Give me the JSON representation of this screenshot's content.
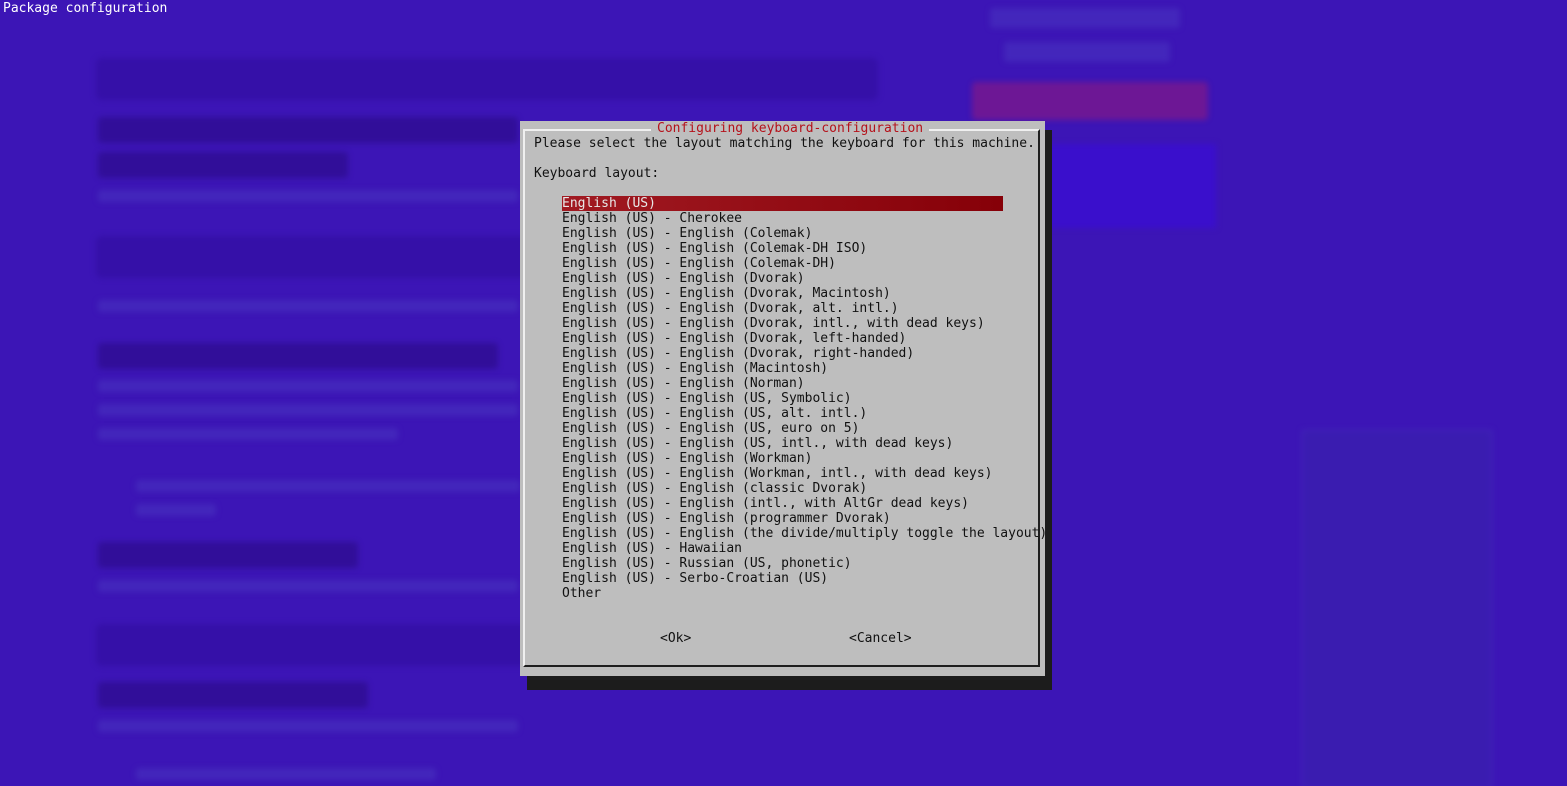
{
  "terminal": {
    "title": "Package configuration"
  },
  "dialog": {
    "title": "Configuring keyboard-configuration",
    "prompt": "Please select the layout matching the keyboard for this machine.",
    "list_label": "Keyboard layout:",
    "selected_index": 0,
    "items": [
      "English (US)",
      "English (US) - Cherokee",
      "English (US) - English (Colemak)",
      "English (US) - English (Colemak-DH ISO)",
      "English (US) - English (Colemak-DH)",
      "English (US) - English (Dvorak)",
      "English (US) - English (Dvorak, Macintosh)",
      "English (US) - English (Dvorak, alt. intl.)",
      "English (US) - English (Dvorak, intl., with dead keys)",
      "English (US) - English (Dvorak, left-handed)",
      "English (US) - English (Dvorak, right-handed)",
      "English (US) - English (Macintosh)",
      "English (US) - English (Norman)",
      "English (US) - English (US, Symbolic)",
      "English (US) - English (US, alt. intl.)",
      "English (US) - English (US, euro on 5)",
      "English (US) - English (US, intl., with dead keys)",
      "English (US) - English (Workman)",
      "English (US) - English (Workman, intl., with dead keys)",
      "English (US) - English (classic Dvorak)",
      "English (US) - English (intl., with AltGr dead keys)",
      "English (US) - English (programmer Dvorak)",
      "English (US) - English (the divide/multiply toggle the layout)",
      "English (US) - Hawaiian",
      "English (US) - Russian (US, phonetic)",
      "English (US) - Serbo-Croatian (US)",
      "Other"
    ],
    "ok_label": "<Ok>",
    "cancel_label": "<Cancel>"
  },
  "colors": {
    "background": "#3c15b6",
    "dialog": "#bebebe",
    "selection": "#a11a22",
    "title_text": "#b5121b"
  }
}
